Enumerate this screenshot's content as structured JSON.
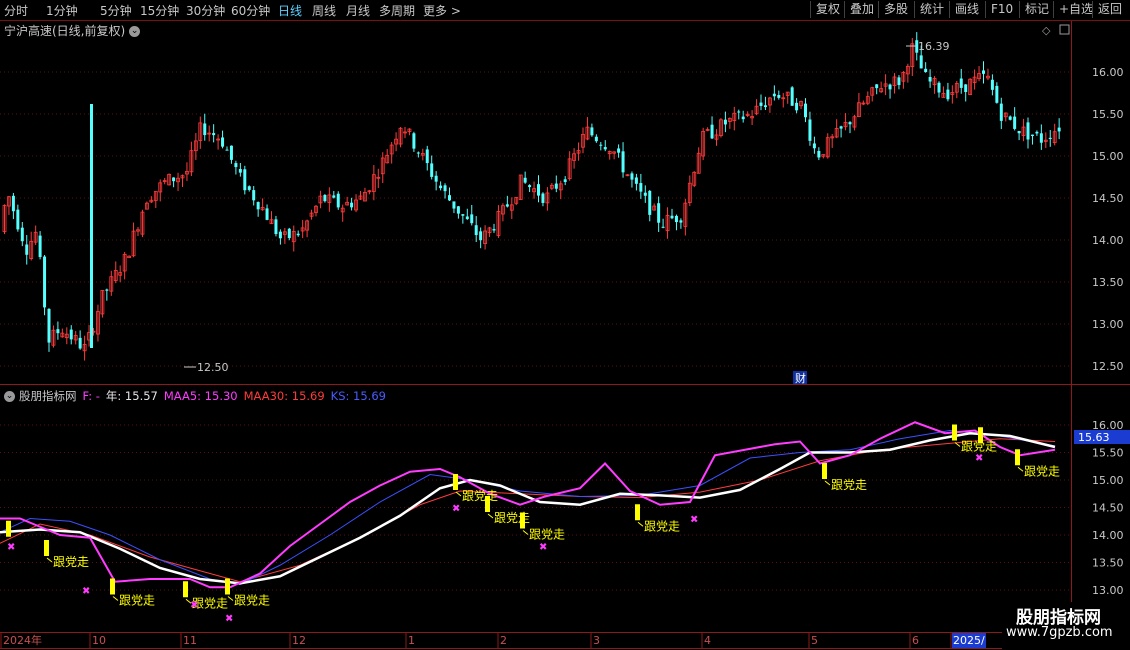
{
  "toolbar": {
    "timeframes": [
      "分时",
      "1分钟",
      "5分钟",
      "15分钟",
      "30分钟",
      "60分钟",
      "日线",
      "周线",
      "月线",
      "多周期",
      "更多"
    ],
    "active_timeframe": "日线",
    "right_buttons": [
      "复权",
      "叠加",
      "多股",
      "统计",
      "画线",
      "F10",
      "标记",
      "+自选",
      "返回"
    ]
  },
  "stock": {
    "title": "宁沪高速(日线,前复权)"
  },
  "price_chart": {
    "y_ticks": [
      "16.00",
      "15.50",
      "15.00",
      "14.50",
      "14.00",
      "13.50",
      "13.00",
      "12.50"
    ],
    "y_values": [
      16.0,
      15.5,
      15.0,
      14.5,
      14.0,
      13.5,
      13.0,
      12.5
    ],
    "high_label": "16.39",
    "low_label": "12.50",
    "finance_badge": "财",
    "colors": {
      "up": "#ff3c3c",
      "down": "#54ffff"
    }
  },
  "indicator": {
    "name": "股朋指标网",
    "f_label": "F: -",
    "year_label": "年: 15.57",
    "maa5": "MAA5: 15.30",
    "maa30": "MAA30: 15.69",
    "ks": "KS: 15.69",
    "y_ticks": [
      "16.00",
      "15.50",
      "15.00",
      "14.50",
      "14.00",
      "13.50",
      "13.00"
    ],
    "y_values": [
      16.0,
      15.5,
      15.0,
      14.5,
      14.0,
      13.5,
      13.0
    ],
    "current_value": "15.63",
    "signal_text": "跟党走",
    "colors": {
      "maa5": "#ff3cff",
      "maa30": "#ff3c3c",
      "ks": "#3c50ff",
      "white": "#ffffff",
      "signal": "#ffff00",
      "cross": "#ff3cff"
    }
  },
  "x_axis": {
    "labels": [
      "2024年",
      "10",
      "11",
      "12",
      "1",
      "2",
      "3",
      "4",
      "5",
      "6",
      "2025/"
    ]
  },
  "watermark": {
    "line1": "股朋指标网",
    "line2": "www.7gpzb.com"
  }
}
